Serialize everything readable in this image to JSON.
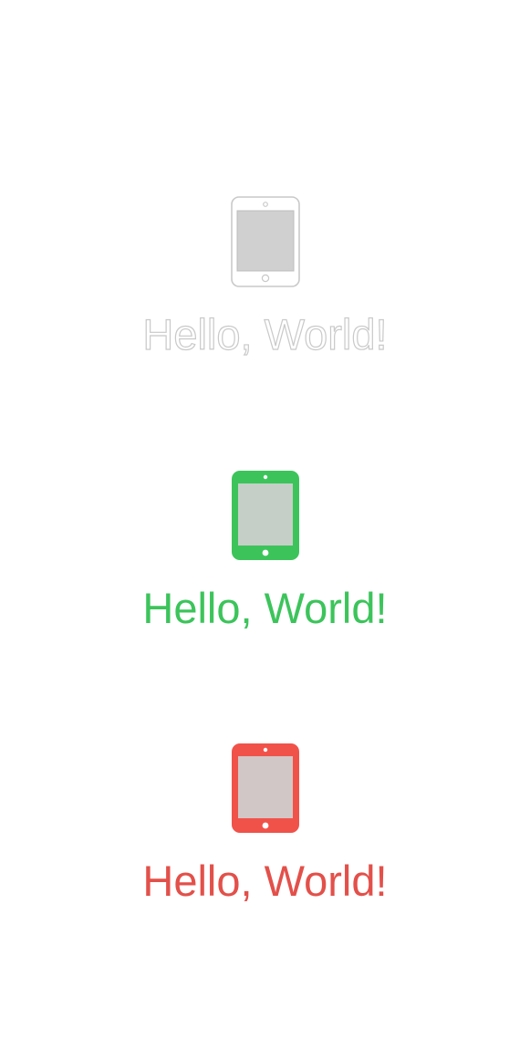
{
  "items": [
    {
      "label": "Hello, World!",
      "style": "outline",
      "icon": "tablet-outline-icon",
      "color": "#c9c9c9",
      "screen_color": "#d0d0d0"
    },
    {
      "label": "Hello, World!",
      "style": "filled",
      "icon": "tablet-filled-icon",
      "color": "#3cc45b",
      "screen_color": "#c6cfc7"
    },
    {
      "label": "Hello, World!",
      "style": "filled",
      "icon": "tablet-filled-icon",
      "color": "#f0524a",
      "screen_color": "#d1c7c6"
    }
  ]
}
